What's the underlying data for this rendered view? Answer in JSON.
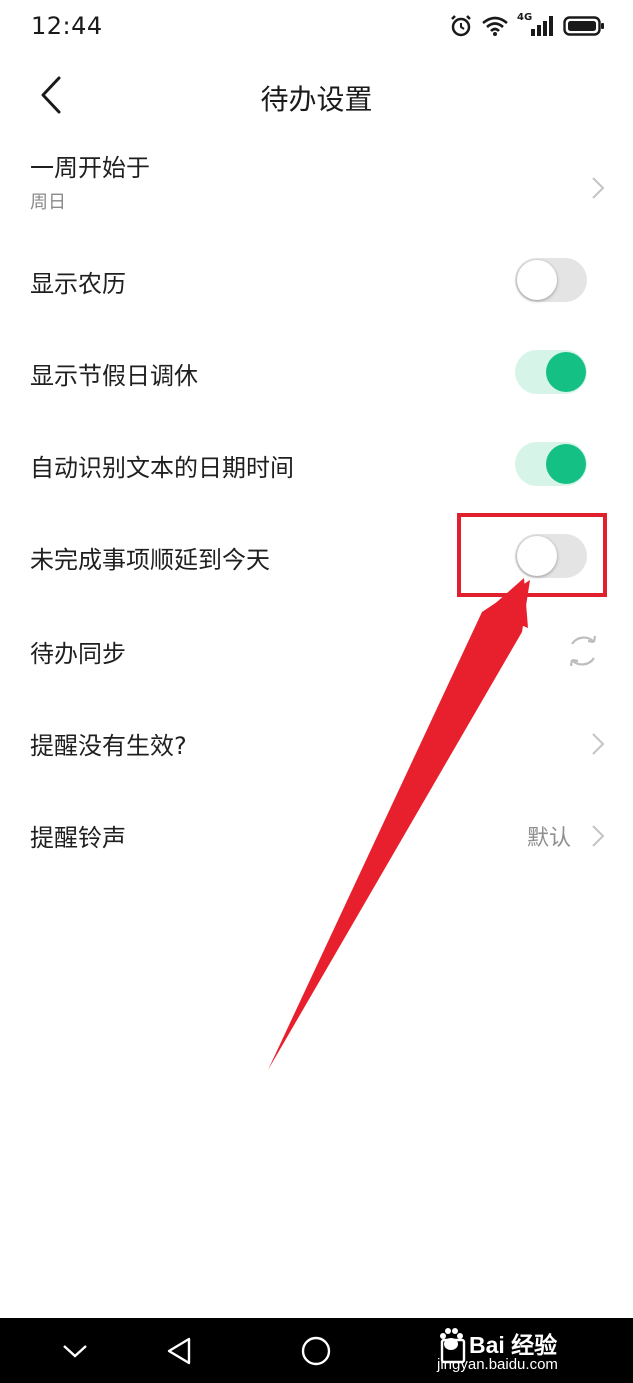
{
  "status_bar": {
    "time": "12:44",
    "network": "4G",
    "icons": [
      "alarm-icon",
      "wifi-icon",
      "signal-icon",
      "battery-icon"
    ]
  },
  "header": {
    "title": "待办设置",
    "back_icon": "chevron-left-icon"
  },
  "settings": [
    {
      "label": "一周开始于",
      "sublabel": "周日",
      "control": "chevron"
    },
    {
      "label": "显示农历",
      "control": "toggle",
      "on": false
    },
    {
      "label": "显示节假日调休",
      "control": "toggle",
      "on": true
    },
    {
      "label": "自动识别文本的日期时间",
      "control": "toggle",
      "on": true
    },
    {
      "label": "未完成事项顺延到今天",
      "control": "toggle",
      "on": false
    },
    {
      "label": "待办同步",
      "control": "sync-icon"
    },
    {
      "label": "提醒没有生效?",
      "control": "chevron"
    },
    {
      "label": "提醒铃声",
      "value": "默认",
      "control": "chevron"
    }
  ],
  "colors": {
    "toggle_on": "#15c084",
    "toggle_on_track": "#d7f4e9",
    "toggle_off_track": "#e4e4e4",
    "annotation": "#e0202c"
  },
  "nav_bar": {
    "icons": [
      "chevron-down-icon",
      "back-triangle-icon",
      "home-circle-icon",
      "recents-square-icon"
    ]
  },
  "watermark": {
    "brand": "Bai  经验",
    "url": "jingyan.baidu.com"
  }
}
